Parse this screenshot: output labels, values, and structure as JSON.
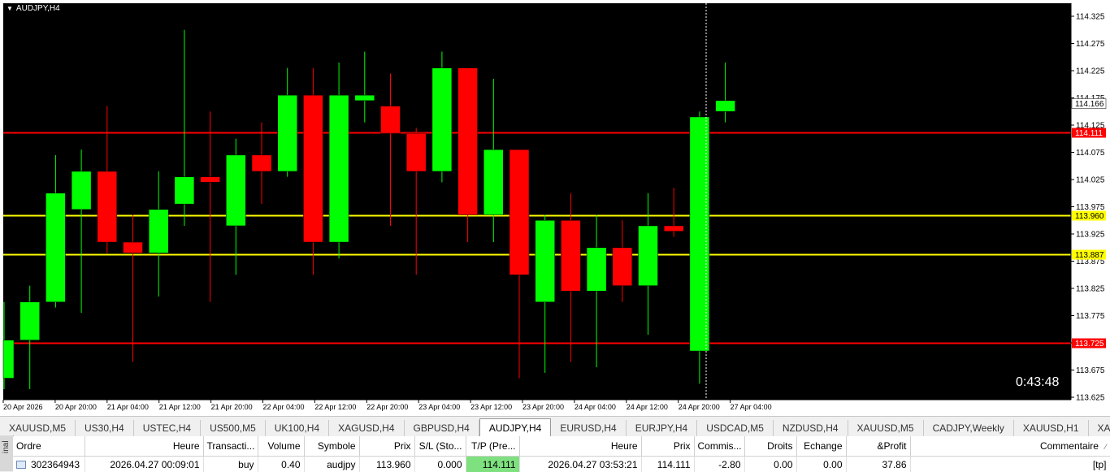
{
  "chart": {
    "symbol_title": "AUDJPY,H4",
    "countdown": "0:43:48",
    "background": "#000000",
    "bull_color": "#00ff00",
    "bear_color": "#ff0000",
    "price_ticks": [
      "114.325",
      "114.275",
      "114.225",
      "114.175",
      "114.125",
      "114.075",
      "114.025",
      "113.975",
      "113.925",
      "113.875",
      "113.825",
      "113.775",
      "113.725",
      "113.675",
      "113.625"
    ],
    "time_labels": [
      "20 Apr 2026",
      "20 Apr 20:00",
      "21 Apr 04:00",
      "21 Apr 12:00",
      "21 Apr 20:00",
      "22 Apr 04:00",
      "22 Apr 12:00",
      "22 Apr 20:00",
      "23 Apr 04:00",
      "23 Apr 12:00",
      "23 Apr 20:00",
      "24 Apr 04:00",
      "24 Apr 12:00",
      "24 Apr 20:00",
      "27 Apr 04:00"
    ],
    "levels": [
      {
        "price": 114.111,
        "label": "114.111",
        "color": "#ff0000",
        "label_bg": "#ff0000",
        "label_fg": "#ffffff"
      },
      {
        "price": 113.96,
        "label": "113.960",
        "color": "#ffff00",
        "label_bg": "#ffff00",
        "label_fg": "#000000"
      },
      {
        "price": 113.887,
        "label": "113.887",
        "color": "#ffff00",
        "label_bg": "#ffff00",
        "label_fg": "#000000"
      },
      {
        "price": 113.725,
        "label": "113.725",
        "color": "#ff0000",
        "label_bg": "#ff0000",
        "label_fg": "#ffffff"
      }
    ],
    "current_price": {
      "price": 114.166,
      "label": "114.166"
    },
    "candles": [
      {
        "o": 113.66,
        "h": 113.8,
        "l": 113.64,
        "c": 113.73
      },
      {
        "o": 113.73,
        "h": 113.83,
        "l": 113.64,
        "c": 113.8
      },
      {
        "o": 113.8,
        "h": 114.07,
        "l": 113.79,
        "c": 114.0
      },
      {
        "o": 113.97,
        "h": 114.08,
        "l": 113.78,
        "c": 114.04
      },
      {
        "o": 114.04,
        "h": 114.16,
        "l": 113.89,
        "c": 113.91
      },
      {
        "o": 113.91,
        "h": 113.96,
        "l": 113.69,
        "c": 113.89
      },
      {
        "o": 113.89,
        "h": 114.04,
        "l": 113.81,
        "c": 113.97
      },
      {
        "o": 113.98,
        "h": 114.3,
        "l": 113.94,
        "c": 114.03
      },
      {
        "o": 114.03,
        "h": 114.15,
        "l": 113.8,
        "c": 114.02
      },
      {
        "o": 113.94,
        "h": 114.1,
        "l": 113.85,
        "c": 114.07
      },
      {
        "o": 114.07,
        "h": 114.13,
        "l": 113.98,
        "c": 114.04
      },
      {
        "o": 114.04,
        "h": 114.23,
        "l": 114.03,
        "c": 114.18
      },
      {
        "o": 114.18,
        "h": 114.23,
        "l": 113.85,
        "c": 113.91
      },
      {
        "o": 113.91,
        "h": 114.24,
        "l": 113.88,
        "c": 114.18
      },
      {
        "o": 114.17,
        "h": 114.26,
        "l": 114.13,
        "c": 114.18
      },
      {
        "o": 114.16,
        "h": 114.22,
        "l": 113.94,
        "c": 114.11
      },
      {
        "o": 114.11,
        "h": 114.12,
        "l": 113.85,
        "c": 114.04
      },
      {
        "o": 114.04,
        "h": 114.26,
        "l": 114.02,
        "c": 114.23
      },
      {
        "o": 114.23,
        "h": 114.23,
        "l": 113.91,
        "c": 113.96
      },
      {
        "o": 113.96,
        "h": 114.21,
        "l": 113.91,
        "c": 114.08
      },
      {
        "o": 114.08,
        "h": 114.08,
        "l": 113.66,
        "c": 113.85
      },
      {
        "o": 113.8,
        "h": 113.96,
        "l": 113.67,
        "c": 113.95
      },
      {
        "o": 113.95,
        "h": 114.0,
        "l": 113.69,
        "c": 113.82
      },
      {
        "o": 113.82,
        "h": 113.96,
        "l": 113.68,
        "c": 113.9
      },
      {
        "o": 113.9,
        "h": 113.95,
        "l": 113.8,
        "c": 113.83
      },
      {
        "o": 113.83,
        "h": 114.0,
        "l": 113.74,
        "c": 113.94
      },
      {
        "o": 113.94,
        "h": 114.01,
        "l": 113.92,
        "c": 113.93
      },
      {
        "o": 113.71,
        "h": 114.15,
        "l": 113.65,
        "c": 114.14
      },
      {
        "o": 114.15,
        "h": 114.24,
        "l": 114.13,
        "c": 114.17
      }
    ]
  },
  "tabs": [
    "XAUUSD,M5",
    "US30,H4",
    "USTEC,H4",
    "US500,M5",
    "UK100,H4",
    "XAGUSD,H4",
    "GBPUSD,H4",
    "AUDJPY,H4",
    "EURUSD,H4",
    "EURJPY,H4",
    "USDCAD,M5",
    "NZDUSD,H4",
    "XAUUSD,M5",
    "CADJPY,Weekly",
    "XAUUSD,H1",
    "XAUUSD,We"
  ],
  "active_tab": "AUDJPY,H4",
  "terminal_label": "inal",
  "table": {
    "headers": [
      "Ordre",
      "Heure",
      "Transacti...",
      "Volume",
      "Symbole",
      "Prix",
      "S/L (Sto...",
      "T/P (Pre...",
      "Heure",
      "Prix",
      "Commis...",
      "Droits",
      "Echange",
      "&Profit",
      "Commentaire"
    ],
    "row": [
      "302364943",
      "2026.04.27 00:09:01",
      "buy",
      "0.40",
      "audjpy",
      "113.960",
      "0.000",
      "114.111",
      "2026.04.27 03:53:21",
      "114.111",
      "-2.80",
      "0.00",
      "0.00",
      "37.86",
      "[tp]"
    ]
  }
}
